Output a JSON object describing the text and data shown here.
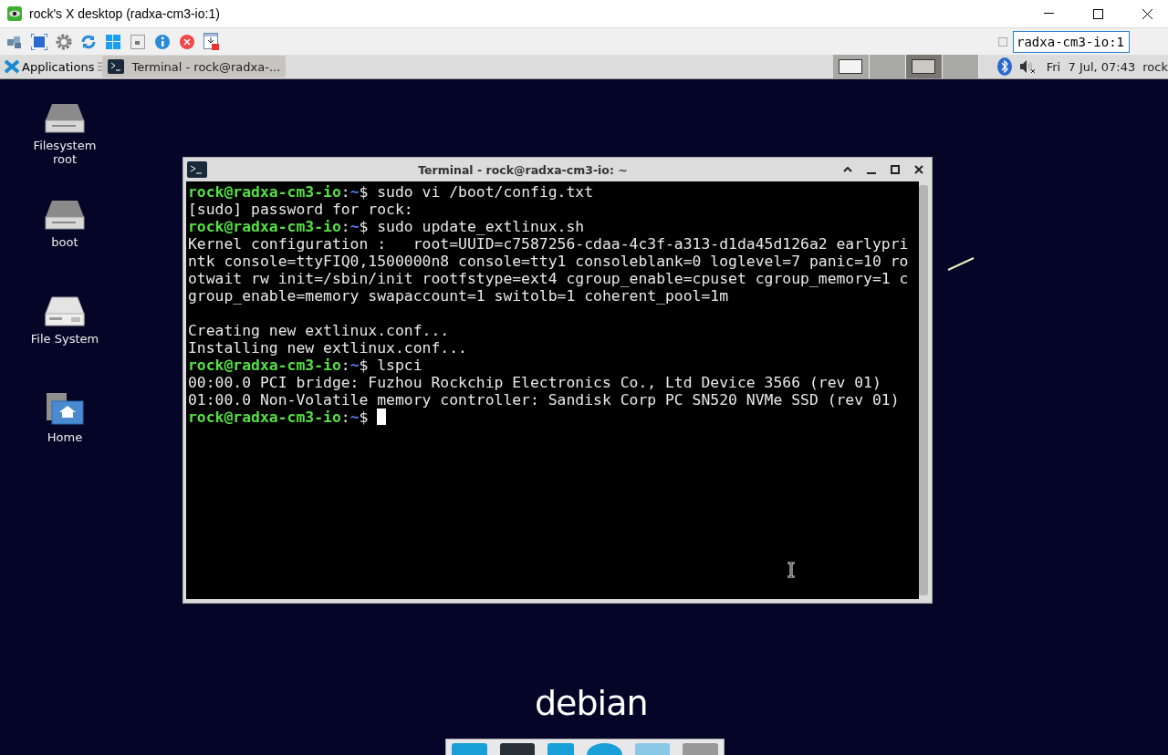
{
  "window": {
    "title": "rock's X desktop (radxa-cm3-io:1)"
  },
  "toolbar": {
    "host_field": "radxa-cm3-io:1"
  },
  "panel": {
    "applications": "Applications",
    "tasks": [
      {
        "label": "Terminal - rock@radxa-...",
        "selected": true
      }
    ],
    "workspaces": [
      {
        "selected": false,
        "has_window": true
      },
      {
        "selected": false,
        "has_window": false
      },
      {
        "selected": true,
        "has_window": true
      },
      {
        "selected": false,
        "has_window": false
      }
    ],
    "clock": "Fri  7 Jul, 07:43",
    "user": "rock"
  },
  "desktop_icons": [
    {
      "label": "Filesystem root",
      "kind": "drive"
    },
    {
      "label": "boot",
      "kind": "drive"
    },
    {
      "label": "File System",
      "kind": "disk"
    },
    {
      "label": "Home",
      "kind": "home"
    }
  ],
  "terminal": {
    "title": "Terminal - rock@radxa-cm3-io: ~",
    "lines": [
      {
        "kind": "prompt",
        "user": "rock@radxa-cm3-io",
        "sep": ":",
        "path": "~",
        "command": "$ sudo vi /boot/config.txt"
      },
      {
        "kind": "output",
        "text": "[sudo] password for rock:"
      },
      {
        "kind": "prompt",
        "user": "rock@radxa-cm3-io",
        "sep": ":",
        "path": "~",
        "command": "$ sudo update_extlinux.sh"
      },
      {
        "kind": "output",
        "text": "Kernel configuration :   root=UUID=c7587256-cdaa-4c3f-a313-d1da45d126a2 earlypri"
      },
      {
        "kind": "output",
        "text": "ntk console=ttyFIQ0,1500000n8 console=tty1 consoleblank=0 loglevel=7 panic=10 ro"
      },
      {
        "kind": "output",
        "text": "otwait rw init=/sbin/init rootfstype=ext4 cgroup_enable=cpuset cgroup_memory=1 c"
      },
      {
        "kind": "output",
        "text": "group_enable=memory swapaccount=1 switolb=1 coherent_pool=1m"
      },
      {
        "kind": "blank"
      },
      {
        "kind": "output",
        "text": "Creating new extlinux.conf..."
      },
      {
        "kind": "output",
        "text": "Installing new extlinux.conf..."
      },
      {
        "kind": "prompt",
        "user": "rock@radxa-cm3-io",
        "sep": ":",
        "path": "~",
        "command": "$ lspci"
      },
      {
        "kind": "output",
        "text": "00:00.0 PCI bridge: Fuzhou Rockchip Electronics Co., Ltd Device 3566 (rev 01)"
      },
      {
        "kind": "output",
        "text": "01:00.0 Non-Volatile memory controller: Sandisk Corp PC SN520 NVMe SSD (rev 01)"
      },
      {
        "kind": "prompt",
        "user": "rock@radxa-cm3-io",
        "sep": ":",
        "path": "~",
        "command": "$ ",
        "cursor": true
      }
    ]
  },
  "logo": "debian"
}
